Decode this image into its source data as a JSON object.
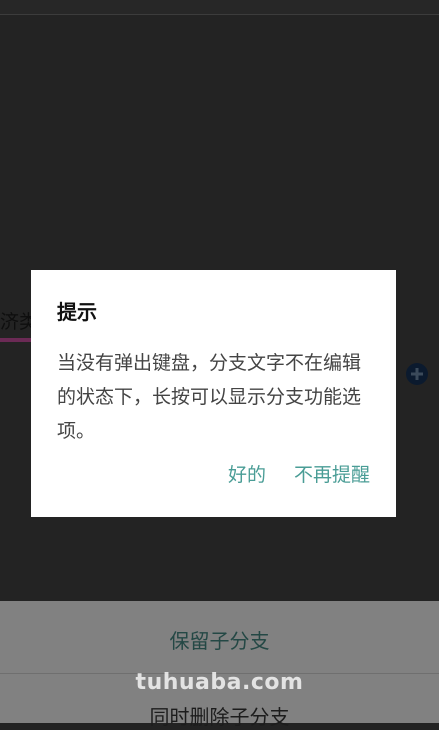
{
  "background": {
    "node_text": "济类"
  },
  "dialog": {
    "title": "提示",
    "message": "当没有弹出键盘，分支文字不在编辑的状态下，长按可以显示分支功能选项。",
    "ok_label": "好的",
    "dont_remind_label": "不再提醒"
  },
  "bottom_sheet": {
    "options": [
      {
        "label": "保留子分支"
      },
      {
        "label": "同时删除子分支"
      }
    ]
  },
  "watermark": "tuhuaba.com",
  "colors": {
    "accent": "#4a9d96",
    "overlay": "#232323",
    "sheet": "#818181"
  }
}
